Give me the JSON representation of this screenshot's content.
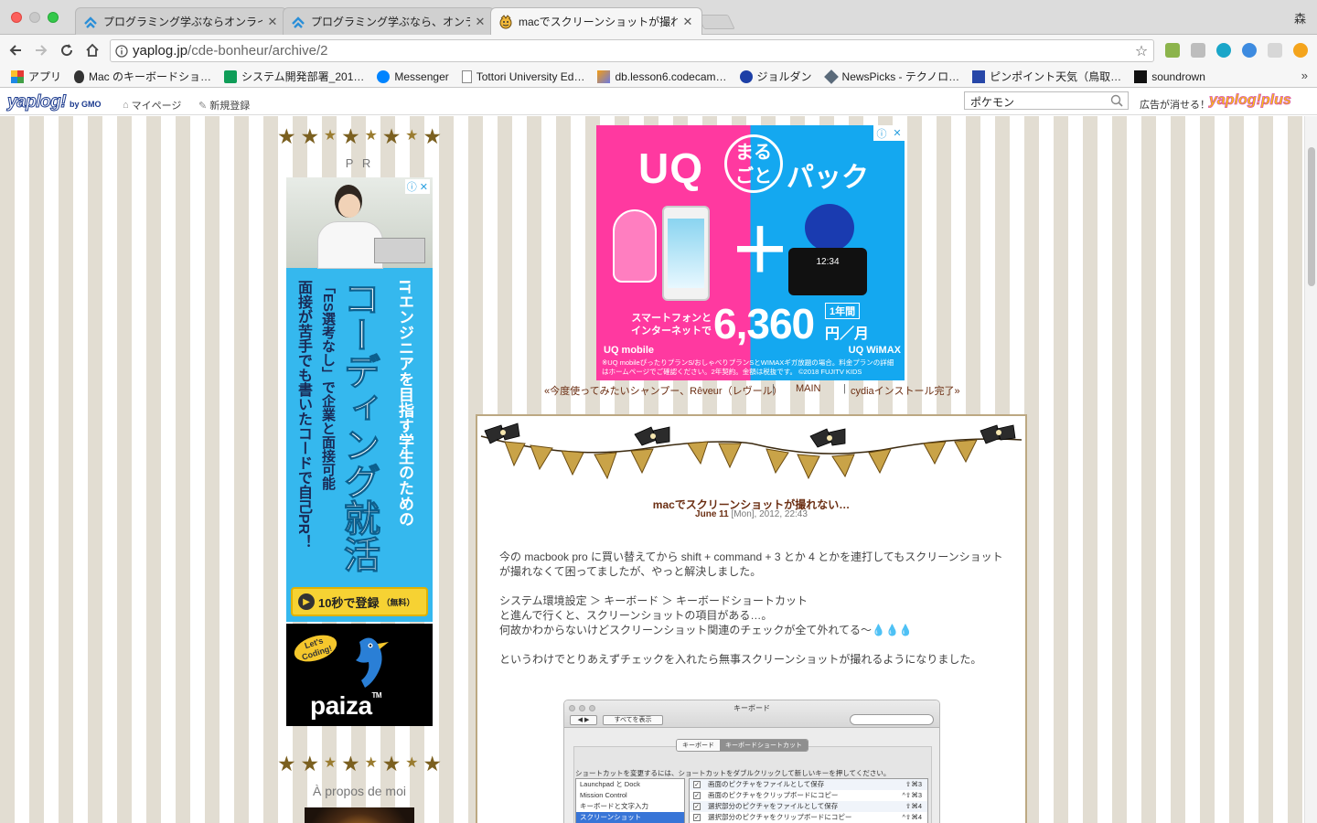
{
  "browser": {
    "tabs": [
      {
        "title": "プログラミング学ぶならオンライン",
        "favicon": "chevron-up-blue-icon",
        "active": false
      },
      {
        "title": "プログラミング学ぶなら、オンライ",
        "favicon": "chevron-up-blue-icon",
        "active": false
      },
      {
        "title": "macでスクリーンショットが撮れな",
        "favicon": "yaplog-face-icon",
        "active": true
      }
    ],
    "profile_name": "森",
    "url_host": "yaplog.jp",
    "url_path": "/cde-bonheur/archive/2",
    "bookmarks": [
      {
        "label": "アプリ",
        "icon": "apps-grid-icon"
      },
      {
        "label": "Mac のキーボードショ…",
        "icon": "apple-icon"
      },
      {
        "label": "システム開発部署_201…",
        "icon": "sheets-icon"
      },
      {
        "label": "Messenger",
        "icon": "messenger-icon"
      },
      {
        "label": "Tottori University Ed…",
        "icon": "page-icon"
      },
      {
        "label": "db.lesson6.codecam…",
        "icon": "pma-icon"
      },
      {
        "label": "ジョルダン",
        "icon": "jorudan-icon"
      },
      {
        "label": "NewsPicks - テクノロ…",
        "icon": "newspicks-icon"
      },
      {
        "label": "ピンポイント天気（鳥取…",
        "icon": "weather-icon"
      },
      {
        "label": "soundrown",
        "icon": "soundrown-icon"
      }
    ],
    "bookmarks_more": "»"
  },
  "yaplog_bar": {
    "logo": "yaplog!",
    "logo_suffix": "by GMO",
    "mypage": "マイページ",
    "register": "新規登録",
    "search_value": "ポケモン",
    "plus_label": "広告が消せる！",
    "plus_logo": "yaplog!plus"
  },
  "sidebar": {
    "pr_title": "P R",
    "about_title": "À propos de moi",
    "ad_paiza": {
      "line1": "ITエンジニアを目指す学生のための",
      "line2": "コーディング就活",
      "line3": "「ES選考なし」で企業と面接可能",
      "line4": "面接が苦手でも書いたコードで自己PR！",
      "cta": "10秒で登録",
      "cta_note": "（無料）",
      "bubble": "Let's Coding!",
      "brand": "paiza",
      "trademark": "TM"
    }
  },
  "top_ad": {
    "brand": "UQ",
    "circle": "まるごと",
    "pack": "パック",
    "plus": "＋",
    "subtitle": "スマートフォンと インターネットで",
    "price": "6,360",
    "period": "1年間",
    "unit": "円／月",
    "left_brand": "UQ mobile",
    "right_brand": "UQ WiMAX",
    "router_time": "12:34",
    "note": "※UQ mobileぴったりプランS/おしゃべりプランSとWIMAXギガ放題の場合。料金プランの詳細はホームページでご確認ください。2年契約。金額は税抜です。 ©2018 FUJITV KIDS"
  },
  "post_nav": {
    "prev": "«今度使ってみたいシャンプー、Rêveur（レヴール）",
    "main": "MAIN",
    "next": "cydiaインストール完了»"
  },
  "entry": {
    "title": "macでスクリーンショットが撮れない…",
    "date_bold": "June 11",
    "date_rest": "[Mon], 2012, 22:43",
    "para1": "今の macbook pro に買い替えてから shift + command + 3 とか 4 とかを連打してもスクリーンショットが撮れなくて困ってましたが、やっと解決しました。",
    "para2_l1": "システム環境設定 ＞ キーボード ＞ キーボードショートカット",
    "para2_l2": "と進んで行くと、スクリーンショットの項目がある…。",
    "para2_l3": "何故かわからないけどスクリーンショット関連のチェックが全て外れてる〜",
    "para2_drops": "💧💧💧",
    "para3": "というわけでとりあえずチェックを入れたら無事スクリーンショットが撮れるようになりました。"
  },
  "screenshot_fig": {
    "window_title": "キーボード",
    "show_all": "すべてを表示",
    "seg_keyboard": "キーボード",
    "seg_shortcuts": "キーボードショートカット",
    "hint": "ショートカットを変更するには、ショートカットをダブルクリックして新しいキーを押してください。",
    "list": [
      "Launchpad と Dock",
      "Mission Control",
      "キーボードと文字入力",
      "スクリーンショット"
    ],
    "rows": [
      {
        "label": "画面のピクチャをファイルとして保存",
        "shortcut": "⇧⌘3"
      },
      {
        "label": "画面のピクチャをクリップボードにコピー",
        "shortcut": "^⇧⌘3"
      },
      {
        "label": "選択部分のピクチャをファイルとして保存",
        "shortcut": "⇧⌘4"
      },
      {
        "label": "選択部分のピクチャをクリップボードにコピー",
        "shortcut": "^⇧⌘4"
      }
    ],
    "check": "✓"
  }
}
